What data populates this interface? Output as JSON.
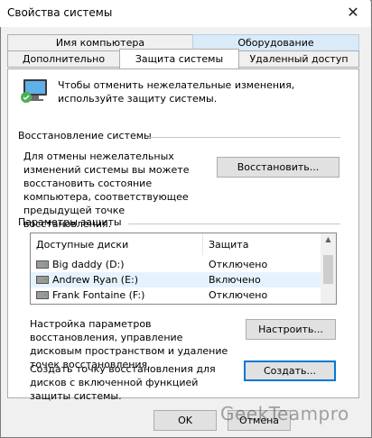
{
  "window": {
    "title": "Свойства системы",
    "close_glyph": "✕"
  },
  "tabs_row1": [
    {
      "label": "Имя компьютера"
    },
    {
      "label": "Оборудование"
    }
  ],
  "tabs_row2": [
    {
      "label": "Дополнительно"
    },
    {
      "label": "Защита системы"
    },
    {
      "label": "Удаленный доступ"
    }
  ],
  "intro": {
    "text": "Чтобы отменить нежелательные изменения, используйте защиту системы."
  },
  "restore": {
    "section_title": "Восстановление системы",
    "text": "Для отмены нежелательных изменений системы вы можете восстановить состояние компьютера, соответствующее предыдущей точке восстановления.",
    "button_label": "Восстановить..."
  },
  "protection": {
    "section_title": "Параметры защиты",
    "col_drives": "Доступные диски",
    "col_protection": "Защита",
    "rows": [
      {
        "drive": "Big daddy (D:)",
        "status": "Отключено"
      },
      {
        "drive": "Andrew Ryan (E:)",
        "status": "Включено"
      },
      {
        "drive": "Frank Fontaine (F:)",
        "status": "Отключено"
      }
    ]
  },
  "configure": {
    "text": "Настройка параметров восстановления, управление дисковым пространством и удаление точек восстановления.",
    "button_label": "Настроить..."
  },
  "create": {
    "text": "Создать точку восстановления для дисков с включенной функцией защиты системы.",
    "button_label": "Создать..."
  },
  "footer": {
    "ok_label": "OK",
    "cancel_label": "Отмена"
  },
  "watermark": "GeekTeampro",
  "colors": {
    "accent": "#0078d7",
    "tab_highlight": "#d9eaf9",
    "selected_row": "#e5f3ff"
  }
}
